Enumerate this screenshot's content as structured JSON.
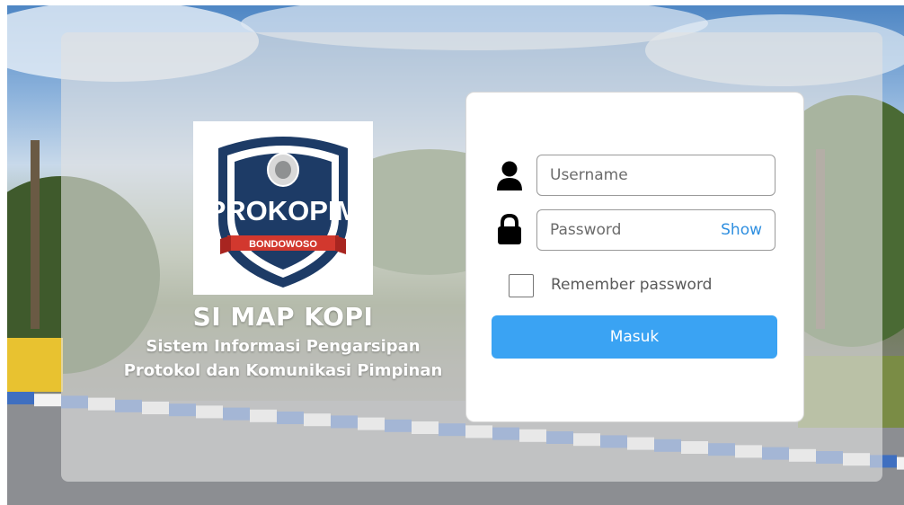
{
  "brand": {
    "logo_text": "PROKOPIM",
    "logo_banner": "BONDOWOSO",
    "title": "SI MAP KOPI",
    "subtitle_line1": "Sistem Informasi Pengarsipan",
    "subtitle_line2": "Protokol dan Komunikasi Pimpinan"
  },
  "login": {
    "username_placeholder": "Username",
    "password_placeholder": "Password",
    "show_label": "Show",
    "remember_label": "Remember password",
    "submit_label": "Masuk",
    "accent_color": "#3aa3f3"
  },
  "icons": {
    "username": "user-icon",
    "password": "lock-icon"
  }
}
